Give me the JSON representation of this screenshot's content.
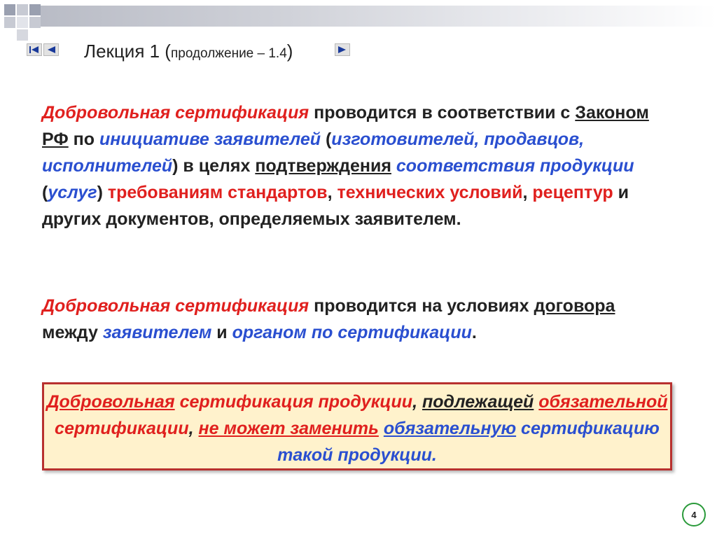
{
  "header": {
    "title_main": "Лекция 1 (",
    "title_sub": "продолжение – 1.4",
    "title_close": ")"
  },
  "icons": {
    "first": "skip-back-icon",
    "prev": "arrow-left-icon",
    "next": "arrow-right-icon"
  },
  "colors": {
    "accent_red": "#e0201e",
    "accent_blue": "#2a4fd0",
    "box_border": "#b8312f",
    "box_fill": "#fff2cc",
    "page_badge": "#2a9a3a"
  },
  "p1": {
    "s1": "Добровольная сертификация",
    "s2": " проводится в соответствии с ",
    "s3": "Законом РФ",
    "s4": " по ",
    "s5": "инициативе заявителей",
    "s6": " (",
    "s7": "изготовителей, продавцов, исполнителей",
    "s8": ") в целях ",
    "s9": "подтверждения",
    "s10": " ",
    "s11": "соответствия продукции",
    "s12": " (",
    "s13": "услуг",
    "s14": ") ",
    "s15": "требованиям стандартов",
    "s16": ", ",
    "s17": "технических условий",
    "s18": ", ",
    "s19": "рецептур",
    "s20": " и других документов, определяемых заявителем."
  },
  "p2": {
    "s1": "Добровольная сертификация",
    "s2": " проводится на условиях ",
    "s3": "договора",
    "s4": " между ",
    "s5": "заявителем",
    "s6": " и ",
    "s7": "органом по сертификации",
    "s8": "."
  },
  "box": {
    "s1": "Добровольная",
    "s2": " сертификация продукции",
    "s3": ", ",
    "s4": "подлежащей",
    "s5": " ",
    "s6": "обязательной",
    "s7": " сертификации",
    "s8": ", ",
    "s9": "не может заменить",
    "s10": " ",
    "s11": "обязательную",
    "s12": " сертификацию такой продукции."
  },
  "page": {
    "number": "4"
  }
}
